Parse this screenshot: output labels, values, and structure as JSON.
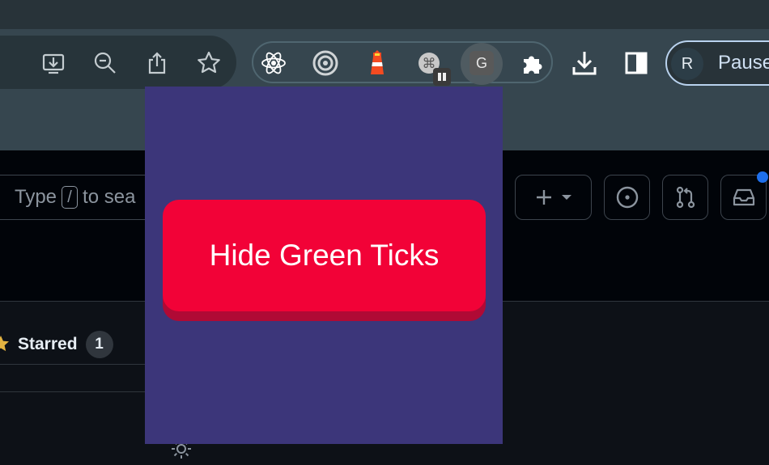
{
  "browser": {
    "toolbar_icons": [
      "install-app-icon",
      "zoom-out-icon",
      "share-icon",
      "bookmark-star-icon"
    ],
    "extensions": [
      "react-devtools-icon",
      "target-extension-icon",
      "lighthouse-icon",
      "command-extension-icon",
      "g-extension-icon",
      "puzzle-extensions-icon"
    ],
    "g_extension_letter": "G",
    "profile": {
      "initial": "R",
      "label": "Pause"
    }
  },
  "github": {
    "search": {
      "before": "Type",
      "key": "/",
      "after": "to sea"
    },
    "subnav": {
      "starred_label": "Starred",
      "starred_count": "1"
    }
  },
  "popup": {
    "button_label": "Hide Green Ticks",
    "colors": {
      "background": "#3c367a",
      "button": "#f20237",
      "button_shadow": "#b00a35"
    }
  }
}
